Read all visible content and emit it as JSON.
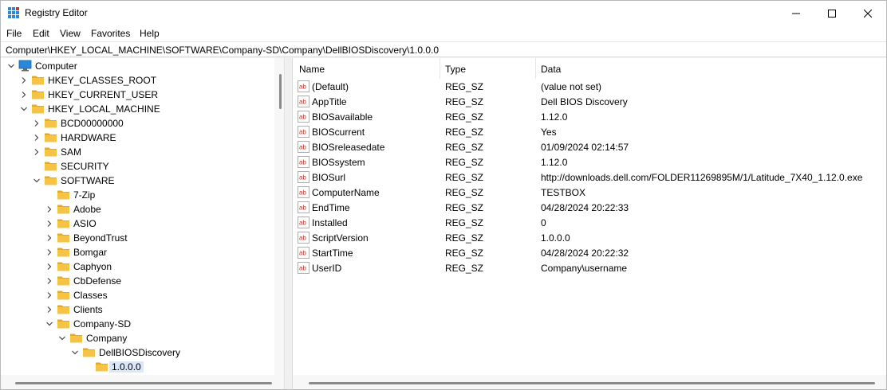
{
  "window": {
    "title": "Registry Editor"
  },
  "menu": [
    "File",
    "Edit",
    "View",
    "Favorites",
    "Help"
  ],
  "address": "Computer\\HKEY_LOCAL_MACHINE\\SOFTWARE\\Company-SD\\Company\\DellBIOSDiscovery\\1.0.0.0",
  "tree": [
    {
      "label": "Computer",
      "depth": 0,
      "state": "expanded",
      "icon": "computer-icon"
    },
    {
      "label": "HKEY_CLASSES_ROOT",
      "depth": 1,
      "state": "collapsed",
      "icon": "folder-icon"
    },
    {
      "label": "HKEY_CURRENT_USER",
      "depth": 1,
      "state": "collapsed",
      "icon": "folder-icon"
    },
    {
      "label": "HKEY_LOCAL_MACHINE",
      "depth": 1,
      "state": "expanded",
      "icon": "folder-icon"
    },
    {
      "label": "BCD00000000",
      "depth": 2,
      "state": "collapsed",
      "icon": "folder-icon"
    },
    {
      "label": "HARDWARE",
      "depth": 2,
      "state": "collapsed",
      "icon": "folder-icon"
    },
    {
      "label": "SAM",
      "depth": 2,
      "state": "collapsed",
      "icon": "folder-icon"
    },
    {
      "label": "SECURITY",
      "depth": 2,
      "state": "none",
      "icon": "folder-icon"
    },
    {
      "label": "SOFTWARE",
      "depth": 2,
      "state": "expanded",
      "icon": "folder-icon"
    },
    {
      "label": "7-Zip",
      "depth": 3,
      "state": "none",
      "icon": "folder-icon"
    },
    {
      "label": "Adobe",
      "depth": 3,
      "state": "collapsed",
      "icon": "folder-icon"
    },
    {
      "label": "ASIO",
      "depth": 3,
      "state": "collapsed",
      "icon": "folder-icon"
    },
    {
      "label": "BeyondTrust",
      "depth": 3,
      "state": "collapsed",
      "icon": "folder-icon"
    },
    {
      "label": "Bomgar",
      "depth": 3,
      "state": "collapsed",
      "icon": "folder-icon"
    },
    {
      "label": "Caphyon",
      "depth": 3,
      "state": "collapsed",
      "icon": "folder-icon"
    },
    {
      "label": "CbDefense",
      "depth": 3,
      "state": "collapsed",
      "icon": "folder-icon"
    },
    {
      "label": "Classes",
      "depth": 3,
      "state": "collapsed",
      "icon": "folder-icon"
    },
    {
      "label": "Clients",
      "depth": 3,
      "state": "collapsed",
      "icon": "folder-icon"
    },
    {
      "label": "Company-SD",
      "depth": 3,
      "state": "expanded",
      "icon": "folder-icon"
    },
    {
      "label": "Company",
      "depth": 4,
      "state": "expanded",
      "icon": "folder-icon"
    },
    {
      "label": "DellBIOSDiscovery",
      "depth": 5,
      "state": "expanded",
      "icon": "folder-icon"
    },
    {
      "label": "1.0.0.0",
      "depth": 6,
      "state": "none",
      "icon": "folder-icon",
      "selected": true
    }
  ],
  "columns": {
    "name": "Name",
    "type": "Type",
    "data": "Data"
  },
  "values": [
    {
      "name": "(Default)",
      "type": "REG_SZ",
      "data": "(value not set)"
    },
    {
      "name": "AppTitle",
      "type": "REG_SZ",
      "data": "Dell BIOS Discovery"
    },
    {
      "name": "BIOSavailable",
      "type": "REG_SZ",
      "data": "1.12.0"
    },
    {
      "name": "BIOScurrent",
      "type": "REG_SZ",
      "data": "Yes"
    },
    {
      "name": "BIOSreleasedate",
      "type": "REG_SZ",
      "data": "01/09/2024 02:14:57"
    },
    {
      "name": "BIOSsystem",
      "type": "REG_SZ",
      "data": "1.12.0"
    },
    {
      "name": "BIOSurl",
      "type": "REG_SZ",
      "data": "http://downloads.dell.com/FOLDER11269895M/1/Latitude_7X40_1.12.0.exe"
    },
    {
      "name": "ComputerName",
      "type": "REG_SZ",
      "data": "TESTBOX"
    },
    {
      "name": "EndTime",
      "type": "REG_SZ",
      "data": "04/28/2024 20:22:33"
    },
    {
      "name": "Installed",
      "type": "REG_SZ",
      "data": "0"
    },
    {
      "name": "ScriptVersion",
      "type": "REG_SZ",
      "data": "1.0.0.0"
    },
    {
      "name": "StartTime",
      "type": "REG_SZ",
      "data": "04/28/2024 20:22:32"
    },
    {
      "name": "UserID",
      "type": "REG_SZ",
      "data": "Company\\username"
    }
  ],
  "colors": {
    "folder": "#f6c445",
    "folder_dark": "#e4a82a",
    "selection": "#dbe6f7",
    "string_icon": "#c0392b",
    "computer": "#2b88d8"
  }
}
